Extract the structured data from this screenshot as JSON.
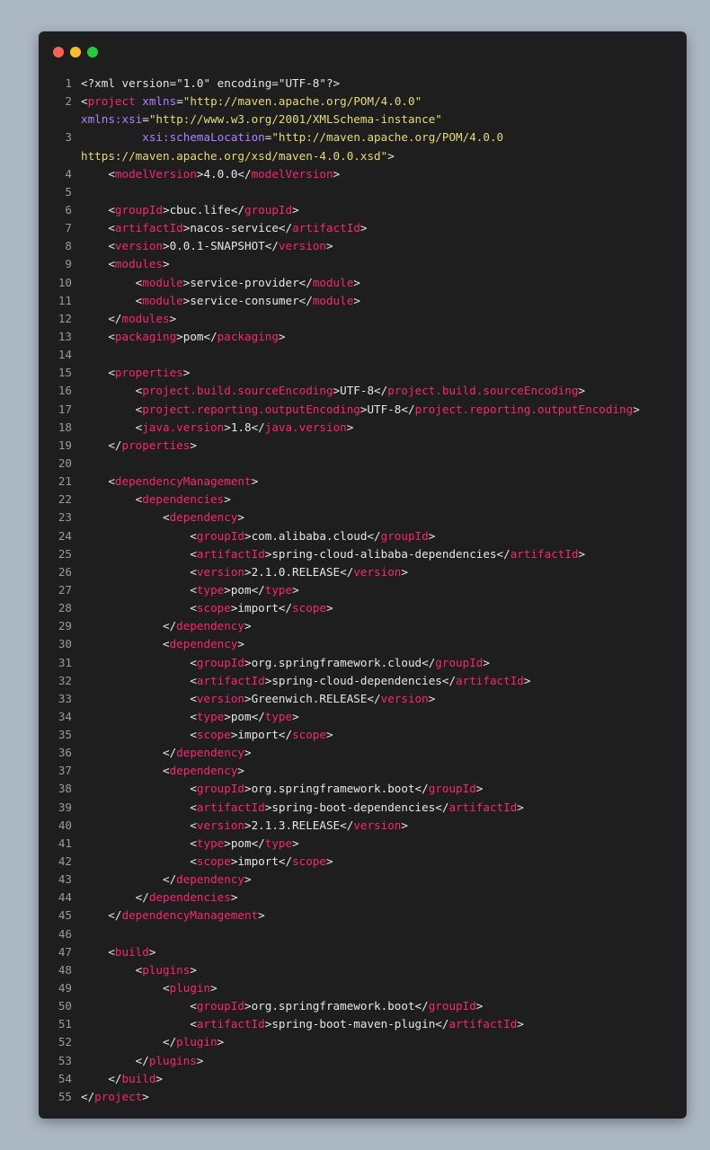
{
  "colors": {
    "background": "#abb8c3",
    "editor_background": "#1e1e1e",
    "line_number": "#9a9a9a",
    "text": "#e6e6e6",
    "tag": "#f92672",
    "attribute": "#ae81ff",
    "string": "#e6db74"
  },
  "window_controls": [
    {
      "name": "close-dot",
      "color": "#ff5f56"
    },
    {
      "name": "minimize-dot",
      "color": "#ffbd2e"
    },
    {
      "name": "zoom-dot",
      "color": "#27c93f"
    }
  ],
  "lines": [
    {
      "n": "1",
      "tokens": [
        [
          "p",
          "<?xml version=\"1.0\" encoding=\"UTF-8\"?>"
        ]
      ]
    },
    {
      "n": "2",
      "tokens": [
        [
          "p",
          "<"
        ],
        [
          "t",
          "project"
        ],
        [
          "p",
          " "
        ],
        [
          "a",
          "xmlns"
        ],
        [
          "p",
          "="
        ],
        [
          "s",
          "\"http://maven.apache.org/POM/4.0.0\""
        ]
      ]
    },
    {
      "n": "",
      "tokens": [
        [
          "a",
          "xmlns:xsi"
        ],
        [
          "p",
          "="
        ],
        [
          "s",
          "\"http://www.w3.org/2001/XMLSchema-instance\""
        ]
      ]
    },
    {
      "n": "3",
      "tokens": [
        [
          "p",
          "         "
        ],
        [
          "a",
          "xsi:schemaLocation"
        ],
        [
          "p",
          "="
        ],
        [
          "s",
          "\"http://maven.apache.org/POM/4.0.0"
        ]
      ]
    },
    {
      "n": "",
      "tokens": [
        [
          "s",
          "https://maven.apache.org/xsd/maven-4.0.0.xsd\""
        ],
        [
          "p",
          ">"
        ]
      ]
    },
    {
      "n": "4",
      "tokens": [
        [
          "p",
          "    <"
        ],
        [
          "t",
          "modelVersion"
        ],
        [
          "p",
          ">4.0.0</"
        ],
        [
          "t",
          "modelVersion"
        ],
        [
          "p",
          ">"
        ]
      ]
    },
    {
      "n": "5",
      "tokens": []
    },
    {
      "n": "6",
      "tokens": [
        [
          "p",
          "    <"
        ],
        [
          "t",
          "groupId"
        ],
        [
          "p",
          ">cbuc.life</"
        ],
        [
          "t",
          "groupId"
        ],
        [
          "p",
          ">"
        ]
      ]
    },
    {
      "n": "7",
      "tokens": [
        [
          "p",
          "    <"
        ],
        [
          "t",
          "artifactId"
        ],
        [
          "p",
          ">nacos-service</"
        ],
        [
          "t",
          "artifactId"
        ],
        [
          "p",
          ">"
        ]
      ]
    },
    {
      "n": "8",
      "tokens": [
        [
          "p",
          "    <"
        ],
        [
          "t",
          "version"
        ],
        [
          "p",
          ">0.0.1-SNAPSHOT</"
        ],
        [
          "t",
          "version"
        ],
        [
          "p",
          ">"
        ]
      ]
    },
    {
      "n": "9",
      "tokens": [
        [
          "p",
          "    <"
        ],
        [
          "t",
          "modules"
        ],
        [
          "p",
          ">"
        ]
      ]
    },
    {
      "n": "10",
      "tokens": [
        [
          "p",
          "        <"
        ],
        [
          "t",
          "module"
        ],
        [
          "p",
          ">service-provider</"
        ],
        [
          "t",
          "module"
        ],
        [
          "p",
          ">"
        ]
      ]
    },
    {
      "n": "11",
      "tokens": [
        [
          "p",
          "        <"
        ],
        [
          "t",
          "module"
        ],
        [
          "p",
          ">service-consumer</"
        ],
        [
          "t",
          "module"
        ],
        [
          "p",
          ">"
        ]
      ]
    },
    {
      "n": "12",
      "tokens": [
        [
          "p",
          "    </"
        ],
        [
          "t",
          "modules"
        ],
        [
          "p",
          ">"
        ]
      ]
    },
    {
      "n": "13",
      "tokens": [
        [
          "p",
          "    <"
        ],
        [
          "t",
          "packaging"
        ],
        [
          "p",
          ">pom</"
        ],
        [
          "t",
          "packaging"
        ],
        [
          "p",
          ">"
        ]
      ]
    },
    {
      "n": "14",
      "tokens": []
    },
    {
      "n": "15",
      "tokens": [
        [
          "p",
          "    <"
        ],
        [
          "t",
          "properties"
        ],
        [
          "p",
          ">"
        ]
      ]
    },
    {
      "n": "16",
      "tokens": [
        [
          "p",
          "        <"
        ],
        [
          "t",
          "project.build.sourceEncoding"
        ],
        [
          "p",
          ">UTF-8</"
        ],
        [
          "t",
          "project.build.sourceEncoding"
        ],
        [
          "p",
          ">"
        ]
      ]
    },
    {
      "n": "17",
      "tokens": [
        [
          "p",
          "        <"
        ],
        [
          "t",
          "project.reporting.outputEncoding"
        ],
        [
          "p",
          ">UTF-8</"
        ],
        [
          "t",
          "project.reporting.outputEncoding"
        ],
        [
          "p",
          ">"
        ]
      ]
    },
    {
      "n": "18",
      "tokens": [
        [
          "p",
          "        <"
        ],
        [
          "t",
          "java.version"
        ],
        [
          "p",
          ">1.8</"
        ],
        [
          "t",
          "java.version"
        ],
        [
          "p",
          ">"
        ]
      ]
    },
    {
      "n": "19",
      "tokens": [
        [
          "p",
          "    </"
        ],
        [
          "t",
          "properties"
        ],
        [
          "p",
          ">"
        ]
      ]
    },
    {
      "n": "20",
      "tokens": []
    },
    {
      "n": "21",
      "tokens": [
        [
          "p",
          "    <"
        ],
        [
          "t",
          "dependencyManagement"
        ],
        [
          "p",
          ">"
        ]
      ]
    },
    {
      "n": "22",
      "tokens": [
        [
          "p",
          "        <"
        ],
        [
          "t",
          "dependencies"
        ],
        [
          "p",
          ">"
        ]
      ]
    },
    {
      "n": "23",
      "tokens": [
        [
          "p",
          "            <"
        ],
        [
          "t",
          "dependency"
        ],
        [
          "p",
          ">"
        ]
      ]
    },
    {
      "n": "24",
      "tokens": [
        [
          "p",
          "                <"
        ],
        [
          "t",
          "groupId"
        ],
        [
          "p",
          ">com.alibaba.cloud</"
        ],
        [
          "t",
          "groupId"
        ],
        [
          "p",
          ">"
        ]
      ]
    },
    {
      "n": "25",
      "tokens": [
        [
          "p",
          "                <"
        ],
        [
          "t",
          "artifactId"
        ],
        [
          "p",
          ">spring-cloud-alibaba-dependencies</"
        ],
        [
          "t",
          "artifactId"
        ],
        [
          "p",
          ">"
        ]
      ]
    },
    {
      "n": "26",
      "tokens": [
        [
          "p",
          "                <"
        ],
        [
          "t",
          "version"
        ],
        [
          "p",
          ">2.1.0.RELEASE</"
        ],
        [
          "t",
          "version"
        ],
        [
          "p",
          ">"
        ]
      ]
    },
    {
      "n": "27",
      "tokens": [
        [
          "p",
          "                <"
        ],
        [
          "t",
          "type"
        ],
        [
          "p",
          ">pom</"
        ],
        [
          "t",
          "type"
        ],
        [
          "p",
          ">"
        ]
      ]
    },
    {
      "n": "28",
      "tokens": [
        [
          "p",
          "                <"
        ],
        [
          "t",
          "scope"
        ],
        [
          "p",
          ">import</"
        ],
        [
          "t",
          "scope"
        ],
        [
          "p",
          ">"
        ]
      ]
    },
    {
      "n": "29",
      "tokens": [
        [
          "p",
          "            </"
        ],
        [
          "t",
          "dependency"
        ],
        [
          "p",
          ">"
        ]
      ]
    },
    {
      "n": "30",
      "tokens": [
        [
          "p",
          "            <"
        ],
        [
          "t",
          "dependency"
        ],
        [
          "p",
          ">"
        ]
      ]
    },
    {
      "n": "31",
      "tokens": [
        [
          "p",
          "                <"
        ],
        [
          "t",
          "groupId"
        ],
        [
          "p",
          ">org.springframework.cloud</"
        ],
        [
          "t",
          "groupId"
        ],
        [
          "p",
          ">"
        ]
      ]
    },
    {
      "n": "32",
      "tokens": [
        [
          "p",
          "                <"
        ],
        [
          "t",
          "artifactId"
        ],
        [
          "p",
          ">spring-cloud-dependencies</"
        ],
        [
          "t",
          "artifactId"
        ],
        [
          "p",
          ">"
        ]
      ]
    },
    {
      "n": "33",
      "tokens": [
        [
          "p",
          "                <"
        ],
        [
          "t",
          "version"
        ],
        [
          "p",
          ">Greenwich.RELEASE</"
        ],
        [
          "t",
          "version"
        ],
        [
          "p",
          ">"
        ]
      ]
    },
    {
      "n": "34",
      "tokens": [
        [
          "p",
          "                <"
        ],
        [
          "t",
          "type"
        ],
        [
          "p",
          ">pom</"
        ],
        [
          "t",
          "type"
        ],
        [
          "p",
          ">"
        ]
      ]
    },
    {
      "n": "35",
      "tokens": [
        [
          "p",
          "                <"
        ],
        [
          "t",
          "scope"
        ],
        [
          "p",
          ">import</"
        ],
        [
          "t",
          "scope"
        ],
        [
          "p",
          ">"
        ]
      ]
    },
    {
      "n": "36",
      "tokens": [
        [
          "p",
          "            </"
        ],
        [
          "t",
          "dependency"
        ],
        [
          "p",
          ">"
        ]
      ]
    },
    {
      "n": "37",
      "tokens": [
        [
          "p",
          "            <"
        ],
        [
          "t",
          "dependency"
        ],
        [
          "p",
          ">"
        ]
      ]
    },
    {
      "n": "38",
      "tokens": [
        [
          "p",
          "                <"
        ],
        [
          "t",
          "groupId"
        ],
        [
          "p",
          ">org.springframework.boot</"
        ],
        [
          "t",
          "groupId"
        ],
        [
          "p",
          ">"
        ]
      ]
    },
    {
      "n": "39",
      "tokens": [
        [
          "p",
          "                <"
        ],
        [
          "t",
          "artifactId"
        ],
        [
          "p",
          ">spring-boot-dependencies</"
        ],
        [
          "t",
          "artifactId"
        ],
        [
          "p",
          ">"
        ]
      ]
    },
    {
      "n": "40",
      "tokens": [
        [
          "p",
          "                <"
        ],
        [
          "t",
          "version"
        ],
        [
          "p",
          ">2.1.3.RELEASE</"
        ],
        [
          "t",
          "version"
        ],
        [
          "p",
          ">"
        ]
      ]
    },
    {
      "n": "41",
      "tokens": [
        [
          "p",
          "                <"
        ],
        [
          "t",
          "type"
        ],
        [
          "p",
          ">pom</"
        ],
        [
          "t",
          "type"
        ],
        [
          "p",
          ">"
        ]
      ]
    },
    {
      "n": "42",
      "tokens": [
        [
          "p",
          "                <"
        ],
        [
          "t",
          "scope"
        ],
        [
          "p",
          ">import</"
        ],
        [
          "t",
          "scope"
        ],
        [
          "p",
          ">"
        ]
      ]
    },
    {
      "n": "43",
      "tokens": [
        [
          "p",
          "            </"
        ],
        [
          "t",
          "dependency"
        ],
        [
          "p",
          ">"
        ]
      ]
    },
    {
      "n": "44",
      "tokens": [
        [
          "p",
          "        </"
        ],
        [
          "t",
          "dependencies"
        ],
        [
          "p",
          ">"
        ]
      ]
    },
    {
      "n": "45",
      "tokens": [
        [
          "p",
          "    </"
        ],
        [
          "t",
          "dependencyManagement"
        ],
        [
          "p",
          ">"
        ]
      ]
    },
    {
      "n": "46",
      "tokens": []
    },
    {
      "n": "47",
      "tokens": [
        [
          "p",
          "    <"
        ],
        [
          "t",
          "build"
        ],
        [
          "p",
          ">"
        ]
      ]
    },
    {
      "n": "48",
      "tokens": [
        [
          "p",
          "        <"
        ],
        [
          "t",
          "plugins"
        ],
        [
          "p",
          ">"
        ]
      ]
    },
    {
      "n": "49",
      "tokens": [
        [
          "p",
          "            <"
        ],
        [
          "t",
          "plugin"
        ],
        [
          "p",
          ">"
        ]
      ]
    },
    {
      "n": "50",
      "tokens": [
        [
          "p",
          "                <"
        ],
        [
          "t",
          "groupId"
        ],
        [
          "p",
          ">org.springframework.boot</"
        ],
        [
          "t",
          "groupId"
        ],
        [
          "p",
          ">"
        ]
      ]
    },
    {
      "n": "51",
      "tokens": [
        [
          "p",
          "                <"
        ],
        [
          "t",
          "artifactId"
        ],
        [
          "p",
          ">spring-boot-maven-plugin</"
        ],
        [
          "t",
          "artifactId"
        ],
        [
          "p",
          ">"
        ]
      ]
    },
    {
      "n": "52",
      "tokens": [
        [
          "p",
          "            </"
        ],
        [
          "t",
          "plugin"
        ],
        [
          "p",
          ">"
        ]
      ]
    },
    {
      "n": "53",
      "tokens": [
        [
          "p",
          "        </"
        ],
        [
          "t",
          "plugins"
        ],
        [
          "p",
          ">"
        ]
      ]
    },
    {
      "n": "54",
      "tokens": [
        [
          "p",
          "    </"
        ],
        [
          "t",
          "build"
        ],
        [
          "p",
          ">"
        ]
      ]
    },
    {
      "n": "55",
      "tokens": [
        [
          "p",
          "</"
        ],
        [
          "t",
          "project"
        ],
        [
          "p",
          ">"
        ]
      ]
    }
  ]
}
